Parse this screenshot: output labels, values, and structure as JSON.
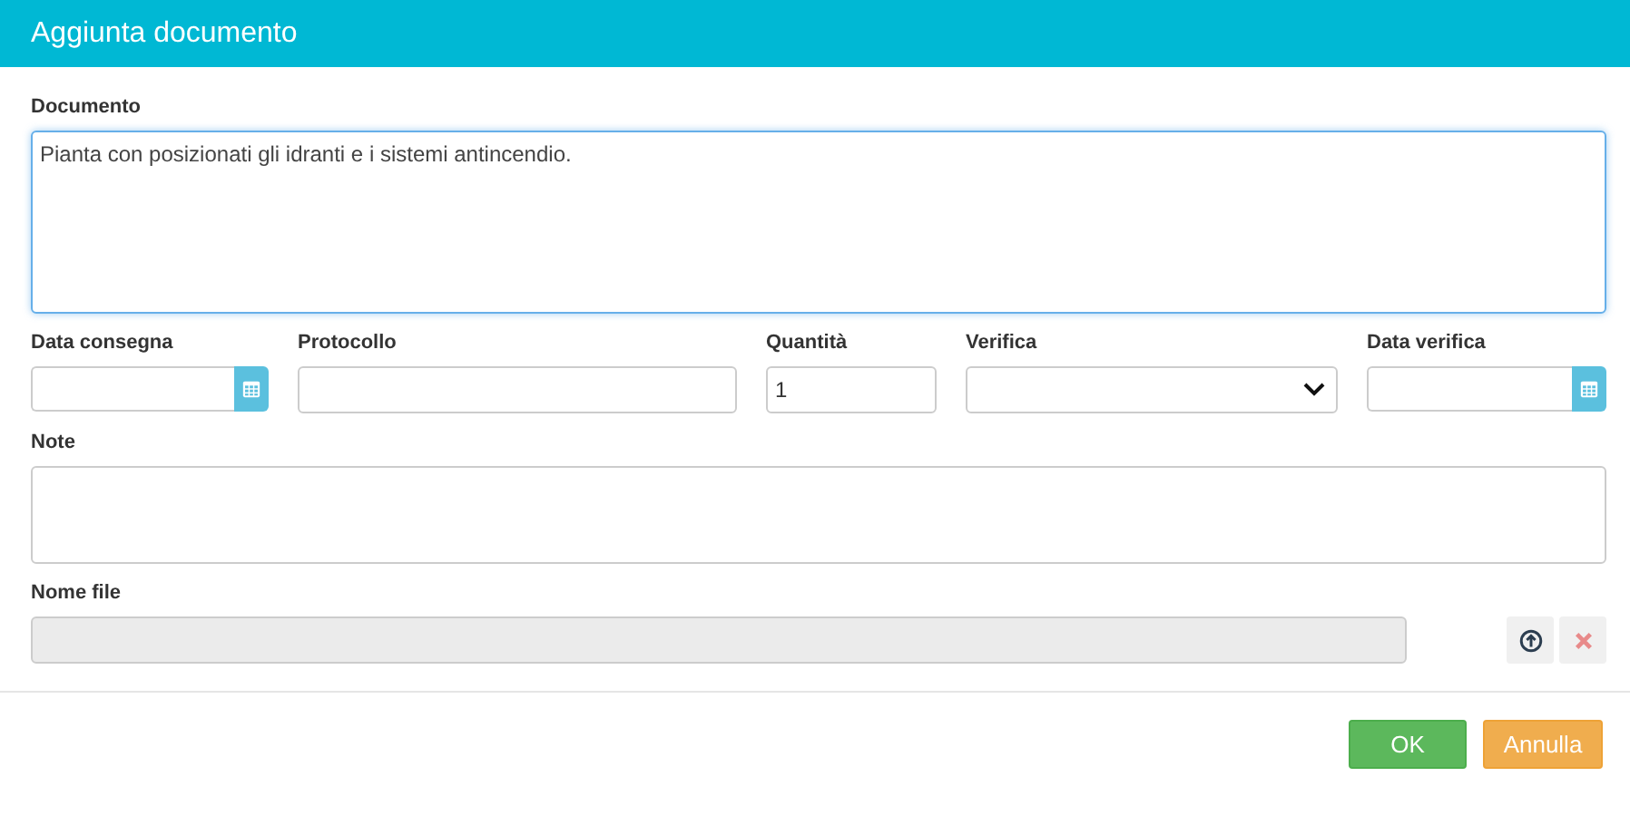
{
  "window": {
    "title": "Aggiunta documento"
  },
  "documento": {
    "label": "Documento",
    "value": "Pianta con posizionati gli idranti e i sistemi antincendio.",
    "focused": true
  },
  "fields": [
    {
      "kind": "date",
      "label": "Data consegna"
    },
    {
      "kind": "text",
      "label": "Protocollo"
    },
    {
      "kind": "text",
      "label": "Quantità",
      "value": "1"
    },
    {
      "kind": "select",
      "label": "Verifica"
    },
    {
      "kind": "date",
      "label": "Data verifica"
    }
  ],
  "note": {
    "label": "Note",
    "focused": false
  },
  "file": {
    "label": "Nome file",
    "disabled": true
  },
  "buttons": [
    {
      "kind": "ok",
      "label": "OK"
    },
    {
      "kind": "cancel",
      "label": "Annulla"
    }
  ]
}
